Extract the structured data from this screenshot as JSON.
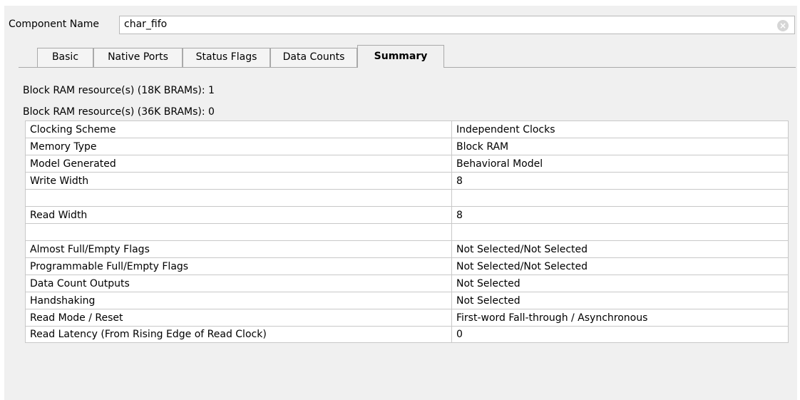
{
  "component": {
    "label": "Component Name",
    "value": "char_fifo",
    "clear_icon": "clear-circle-icon"
  },
  "tabs": [
    {
      "label": "Basic",
      "active": false
    },
    {
      "label": "Native Ports",
      "active": false
    },
    {
      "label": "Status Flags",
      "active": false
    },
    {
      "label": "Data Counts",
      "active": false
    },
    {
      "label": "Summary",
      "active": true
    }
  ],
  "summary": {
    "bram18": "Block RAM resource(s) (18K BRAMs): 1",
    "bram36": "Block RAM resource(s) (36K BRAMs): 0",
    "rows": [
      {
        "name": "Clocking Scheme",
        "value": "Independent Clocks"
      },
      {
        "name": "Memory Type",
        "value": "Block RAM"
      },
      {
        "name": "Model Generated",
        "value": "Behavioral Model"
      },
      {
        "name": "Write Width",
        "value": "8"
      },
      {
        "name": "",
        "value": ""
      },
      {
        "name": "Read Width",
        "value": "8"
      },
      {
        "name": "",
        "value": ""
      },
      {
        "name": "Almost Full/Empty Flags",
        "value": "Not Selected/Not Selected"
      },
      {
        "name": "Programmable Full/Empty Flags",
        "value": "Not Selected/Not Selected"
      },
      {
        "name": "Data Count Outputs",
        "value": "Not Selected"
      },
      {
        "name": "Handshaking",
        "value": "Not Selected"
      },
      {
        "name": "Read Mode / Reset",
        "value": "First-word Fall-through / Asynchronous"
      },
      {
        "name": "Read Latency (From Rising Edge of Read Clock)",
        "value": "0"
      }
    ]
  }
}
